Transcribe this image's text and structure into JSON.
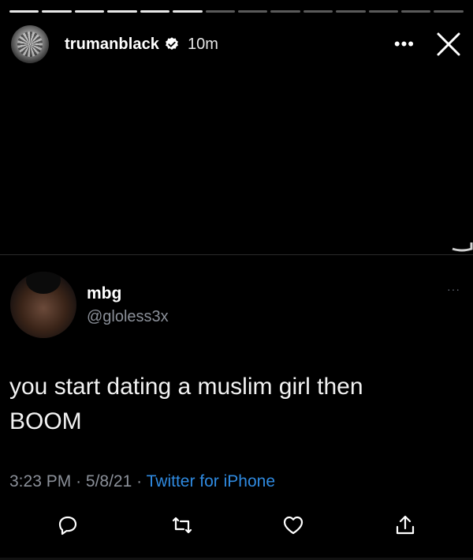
{
  "story": {
    "username": "trumanblack",
    "time_ago": "10m",
    "more_label": "•••",
    "segments_total": 14,
    "segments_done": 6
  },
  "tweet": {
    "display_name": "mbg",
    "handle": "@gloless3x",
    "text_line1": "you start dating a muslim girl then",
    "text_line2": "BOOM",
    "time": "3:23 PM",
    "date": "5/8/21",
    "source": "Twitter for iPhone",
    "sep": "·",
    "more_label": "···"
  },
  "colors": {
    "background": "#000000",
    "handle_gray": "#8b9099",
    "link_blue": "#2f8ae0"
  },
  "icons": [
    "verified-badge-icon",
    "more-icon",
    "close-icon",
    "reply-icon",
    "retweet-icon",
    "like-icon",
    "share-icon"
  ]
}
